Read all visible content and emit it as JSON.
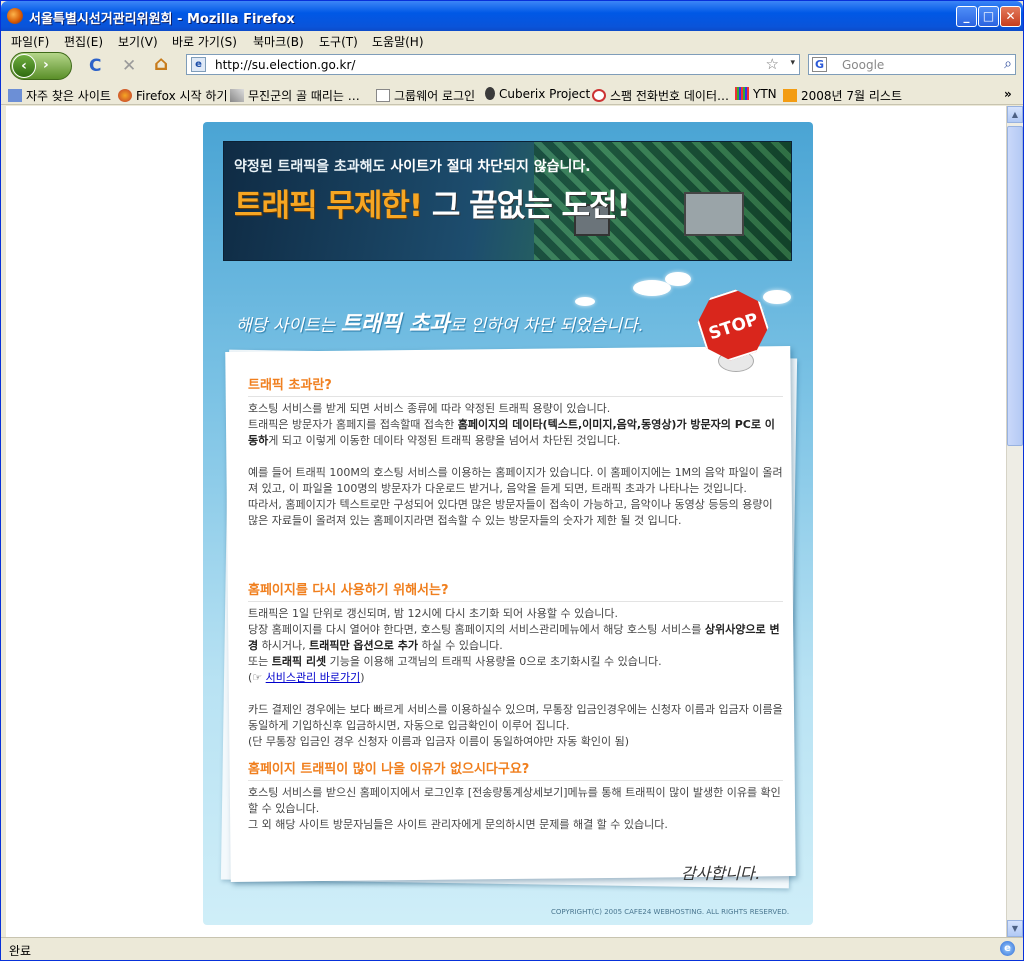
{
  "window": {
    "title": "서울특별시선거관리위원회 - Mozilla Firefox",
    "minimize": "_",
    "maximize": "□",
    "close": "✕"
  },
  "menu": [
    "파일(F)",
    "편집(E)",
    "보기(V)",
    "바로 가기(S)",
    "북마크(B)",
    "도구(T)",
    "도움말(H)"
  ],
  "nav": {
    "back": "‹",
    "forward": "›",
    "reload": "C",
    "stop": "✕",
    "home": "⌂",
    "url": "http://su.election.go.kr/",
    "star": "☆",
    "dropdown": "▾",
    "search_engine": "G",
    "search_placeholder": "Google",
    "search_icon": "⌕"
  },
  "bookmarks": [
    "자주 찾은 사이트",
    "Firefox 시작 하기",
    "무진군의 골 때리는 …",
    "그룹웨어 로그인",
    "Cuberix Project",
    "스팸 전화번호 데이터…",
    "YTN",
    "2008년 7월 리스트"
  ],
  "bookmarks_more": "»",
  "page": {
    "banner_sub_pre": "약정된 트래픽을 초과해도 ",
    "banner_sub_bold": "사이트가 절대 차단되지 않습니다.",
    "banner_big_1": "트래픽 무제한!",
    "banner_big_2": " 그 끝없는 도전!",
    "hand_pre": "해당 사이트는 ",
    "hand_em": "트래픽 초과",
    "hand_post": "로 인하여 차단 되었습니다.",
    "stop_sign": "STOP",
    "sec1_title": "트래픽 초과란?",
    "sec1_l1": "호스팅 서비스를 받게 되면 서비스 종류에 따라 약정된 트래픽 용량이 있습니다.",
    "sec1_l2a": "트래픽은 방문자가 홈페지를 접속할때 접속한 ",
    "sec1_l2b": "홈페이지의 데이타(텍스트,이미지,음악,동영상)가 방문자의 PC로 이동하",
    "sec1_l2c": "게 되고 이렇게 이동한 데이타 약정된 트래픽 용량을 넘어서 차단된 것입니다.",
    "sec1_l3": "예를 들어 트래픽 100M의 호스팅 서비스를 이용하는 홈페이지가 있습니다. 이 홈페이지에는 1M의 음악 파일이 올려져 있고, 이 파일을 100명의 방문자가 다운로드 받거나, 음악을 듣게 되면, 트래픽 초과가 나타나는 것입니다.",
    "sec1_l4": "따라서, 홈페이지가 텍스트로만 구성되어 있다면 많은 방문자들이 접속이 가능하고, 음악이나 동영상 등등의 용량이 많은 자료들이 올려져 있는 홈페이지라면 접속할 수 있는 방문자들의 숫자가 제한 될 것 입니다.",
    "sec2_title": "홈페이지를 다시 사용하기 위해서는?",
    "sec2_l1": "트래픽은 1일 단위로 갱신되며, 밤 12시에 다시 초기화 되어 사용할 수 있습니다.",
    "sec2_l2a": "당장 홈페이지를 다시 열어야 한다면, 호스팅 홈페이지의 서비스관리메뉴에서 해당 호스팅 서비스를 ",
    "sec2_l2b": "상위사양으로 변경",
    "sec2_l2c": " 하시거나, ",
    "sec2_l2d": "트래픽만 옵션으로 추가",
    "sec2_l2e": " 하실 수 있습니다.",
    "sec2_l3a": "또는 ",
    "sec2_l3b": "트래픽 리셋",
    "sec2_l3c": " 기능을 이용해 고객님의 트래픽 사용량을 0으로 초기화시킬 수 있습니다.",
    "sec2_link_pre": "(☞ ",
    "sec2_link": "서비스관리 바로가기",
    "sec2_link_post": ")",
    "sec2_l4": "카드 결제인 경우에는 보다 빠르게 서비스를 이용하실수 있으며, 무통장 입금인경우에는 신청자 이름과 입금자 이름을 동일하게 기입하신후 입금하시면, 자동으로 입금확인이 이루어 집니다.",
    "sec2_l5": "(단 무통장 입금인 경우 신청자 이름과 입금자 이름이 동일하여야만 자동 확인이 됨)",
    "sec3_title": "홈페이지 트래픽이 많이 나올 이유가 없으시다구요?",
    "sec3_l1": "호스팅 서비스를 받으신 홈페이지에서 로그인후 [전송량통계상세보기]메뉴를 통해 트래픽이 많이 발생한 이유를 확인할 수 있습니다.",
    "sec3_l2": "그 외 해당 사이트 방문자님들은 사이트 관리자에게 문의하시면 문제를 해결 할 수 있습니다.",
    "thanks": "감사합니다.",
    "copyright": "COPYRIGHT(C) 2005 CAFE24 WEBHOSTING. ALL RIGHTS RESERVED."
  },
  "status": {
    "text": "완료",
    "icon": "e"
  }
}
